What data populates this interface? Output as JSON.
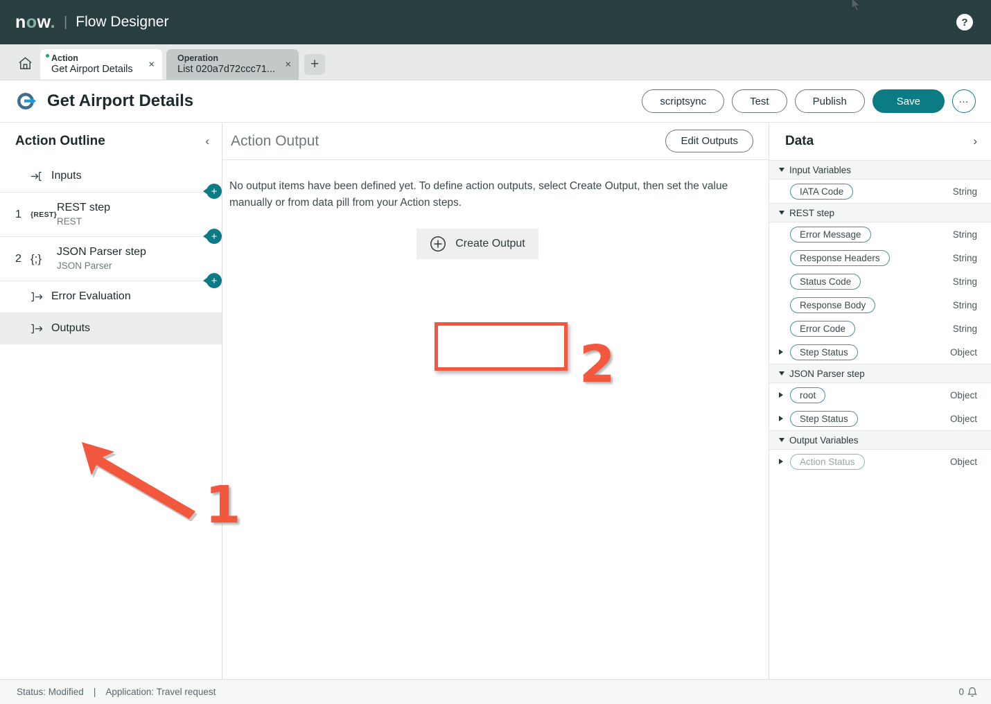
{
  "brand": {
    "logo_text": "now",
    "separator": "|",
    "app_title": "Flow Designer",
    "help_label": "?"
  },
  "tabs": {
    "home_icon": "home-icon",
    "add_label": "+",
    "items": [
      {
        "kind": "Action",
        "name": "Get Airport Details",
        "close": "×",
        "active": true,
        "modified": true
      },
      {
        "kind": "Operation",
        "name": "List 020a7d72ccc71...",
        "close": "×",
        "active": false,
        "modified": false
      }
    ]
  },
  "title_row": {
    "title": "Get Airport Details",
    "buttons": [
      {
        "label": "scriptsync",
        "style": "outline"
      },
      {
        "label": "Test",
        "style": "outline"
      },
      {
        "label": "Publish",
        "style": "outline"
      },
      {
        "label": "Save",
        "style": "primary"
      }
    ],
    "more_label": "…"
  },
  "sidebar": {
    "title": "Action Outline",
    "collapse_label": "‹",
    "items": [
      {
        "num": "",
        "icon": "enter-arrow-icon",
        "label": "Inputs",
        "sub": "",
        "selected": false
      },
      {
        "num": "1",
        "icon": "rest-icon",
        "glyph": "{REST}",
        "label": "REST step",
        "sub": "REST",
        "selected": false
      },
      {
        "num": "2",
        "icon": "json-parser-icon",
        "glyph": "{;}",
        "label": "JSON Parser step",
        "sub": "JSON Parser",
        "selected": false
      },
      {
        "num": "",
        "icon": "exit-arrow-icon",
        "label": "Error Evaluation",
        "sub": "",
        "selected": false
      },
      {
        "num": "",
        "icon": "exit-arrow-icon",
        "label": "Outputs",
        "sub": "",
        "selected": true
      }
    ],
    "add_step_label": "+"
  },
  "main": {
    "heading": "Action Output",
    "edit_outputs_label": "Edit Outputs",
    "empty_message": "No output items have been defined yet. To define action outputs, select Create Output, then set the value manually or from data pill from your Action steps.",
    "create_output_label": "Create Output"
  },
  "annotations": {
    "one": "1",
    "two": "2",
    "accent_color": "#f2583e"
  },
  "data_panel": {
    "title": "Data",
    "expand_label": "›",
    "sections": [
      {
        "name": "Input Variables",
        "rows": [
          {
            "label": "IATA Code",
            "type": "String",
            "expandable": false,
            "muted": false
          }
        ]
      },
      {
        "name": "REST step",
        "rows": [
          {
            "label": "Error Message",
            "type": "String",
            "expandable": false,
            "muted": false
          },
          {
            "label": "Response Headers",
            "type": "String",
            "expandable": false,
            "muted": false
          },
          {
            "label": "Status Code",
            "type": "String",
            "expandable": false,
            "muted": false
          },
          {
            "label": "Response Body",
            "type": "String",
            "expandable": false,
            "muted": false
          },
          {
            "label": "Error Code",
            "type": "String",
            "expandable": false,
            "muted": false
          },
          {
            "label": "Step Status",
            "type": "Object",
            "expandable": true,
            "muted": false
          }
        ]
      },
      {
        "name": "JSON Parser step",
        "rows": [
          {
            "label": "root",
            "type": "Object",
            "expandable": true,
            "muted": false
          },
          {
            "label": "Step Status",
            "type": "Object",
            "expandable": true,
            "muted": false
          }
        ]
      },
      {
        "name": "Output Variables",
        "rows": [
          {
            "label": "Action Status",
            "type": "Object",
            "expandable": true,
            "muted": true
          }
        ]
      }
    ]
  },
  "statusbar": {
    "status": "Status: Modified",
    "separator": "|",
    "application": "Application: Travel request",
    "notification_count": "0",
    "notification_icon": "bell-icon"
  },
  "colors": {
    "header_bg": "#293e40",
    "accent_teal": "#0c7c84",
    "pill_border": "#4b8f99",
    "annotation_red": "#f2583e"
  }
}
